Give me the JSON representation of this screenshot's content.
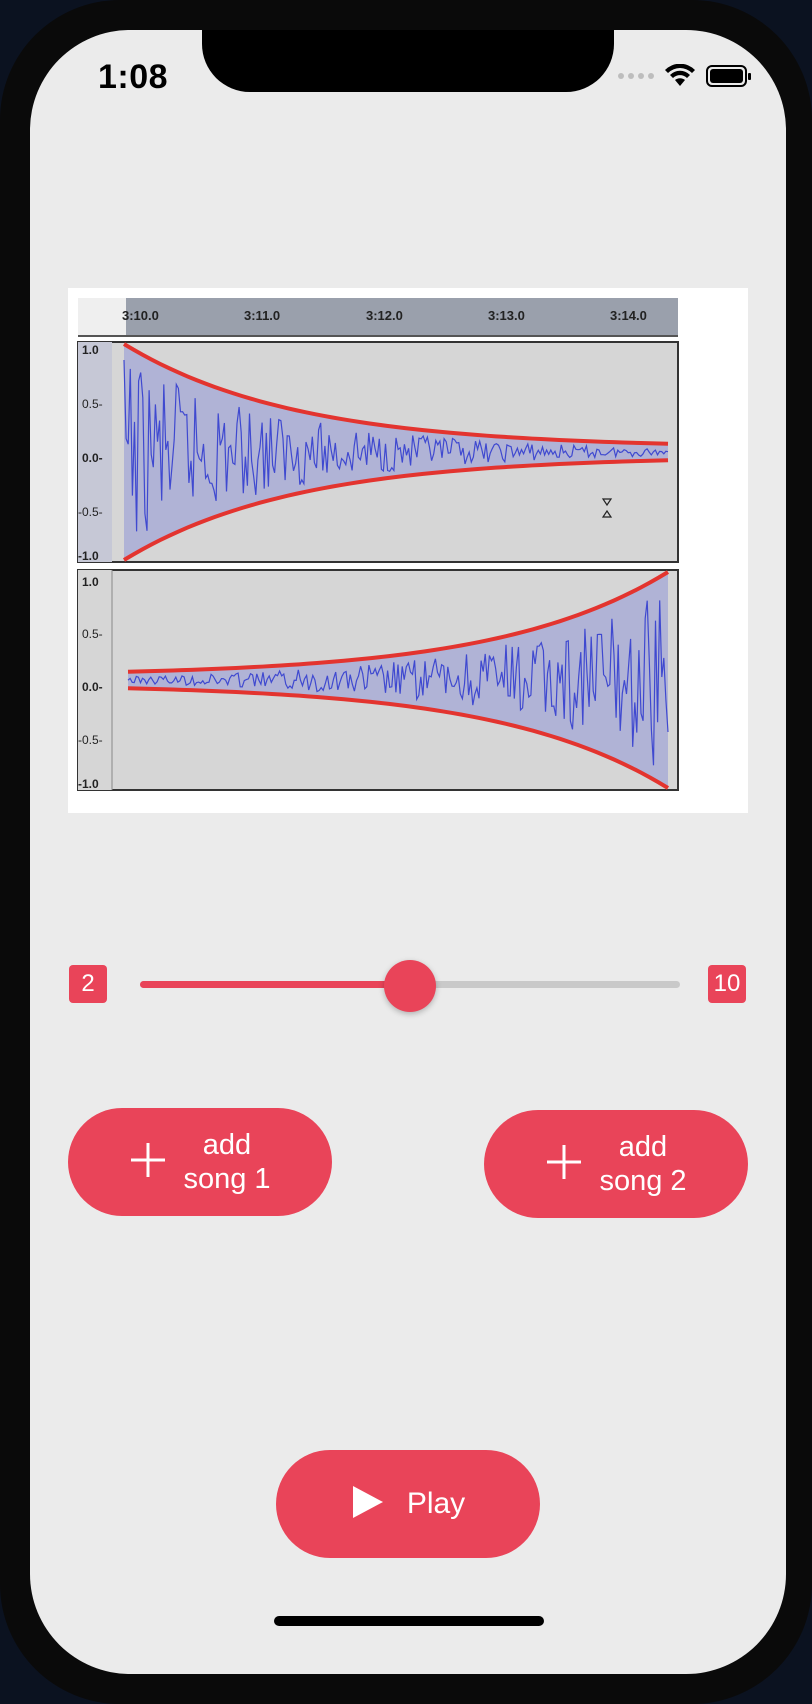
{
  "status_bar": {
    "time": "1:08"
  },
  "waveform": {
    "ruler_labels": [
      "3:10.0",
      "3:11.0",
      "3:12.0",
      "3:13.0",
      "3:14.0"
    ],
    "track_axis_labels": [
      "1.0",
      "0.5-",
      "0.0-",
      "-0.5-",
      "-1.0"
    ]
  },
  "slider": {
    "min_label": "2",
    "max_label": "10",
    "value_fraction": 0.5
  },
  "buttons": {
    "add_song_1": {
      "line1": "add",
      "line2": "song 1"
    },
    "add_song_2": {
      "line1": "add",
      "line2": "song 2"
    },
    "play": "Play"
  },
  "colors": {
    "accent": "#e94459",
    "background": "#ebebeb"
  },
  "icons": {
    "add": "plus-icon",
    "play": "play-icon"
  }
}
